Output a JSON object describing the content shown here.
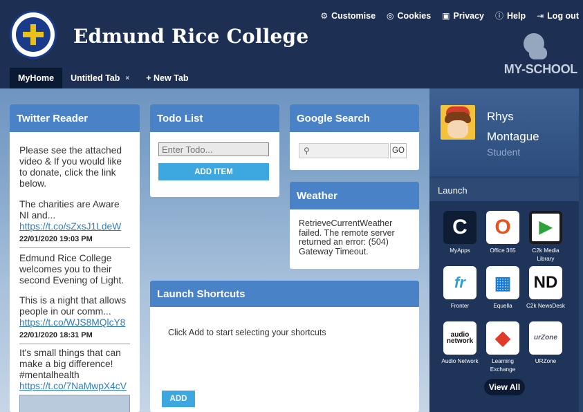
{
  "header": {
    "school_name": "Edmund Rice College",
    "links": [
      {
        "label": "Customise",
        "icon": "gear-icon"
      },
      {
        "label": "Cookies",
        "icon": "cookie-icon"
      },
      {
        "label": "Privacy",
        "icon": "privacy-icon"
      },
      {
        "label": "Help",
        "icon": "help-icon"
      },
      {
        "label": "Log out",
        "icon": "logout-icon"
      }
    ],
    "brand": "MY-SCHOOL"
  },
  "tabs": [
    {
      "label": "MyHome"
    },
    {
      "label": "Untitled Tab",
      "close": "×"
    },
    {
      "label": "+ New Tab"
    }
  ],
  "twitter": {
    "title": "Twitter Reader",
    "tweets": [
      {
        "text": "Please see the attached video & If you would like to donate, click the link below.",
        "link": "",
        "date": ""
      },
      {
        "text": "The charities are Aware NI and...",
        "link": "https://t.co/sZxsJ1LdeW",
        "date": "22/01/2020 19:03 PM"
      },
      {
        "text": "Edmund Rice College welcomes you to their second Evening of Light.",
        "link": "",
        "date": ""
      },
      {
        "text": "This is a night that allows people in our comm...",
        "link": "https://t.co/WJS8MQlcY8",
        "date": "22/01/2020 18:31 PM"
      },
      {
        "text": "It's small things that can make a big difference! #mentalhealth",
        "link": "https://t.co/7NaMwpX4cV",
        "date": ""
      }
    ]
  },
  "todo": {
    "title": "Todo List",
    "placeholder": "Enter Todo...",
    "add_label": "ADD ITEM"
  },
  "google": {
    "title": "Google Search",
    "go_label": "GO"
  },
  "weather": {
    "title": "Weather",
    "message": "RetrieveCurrentWeather failed. The remote server returned an error: (504) Gateway Timeout."
  },
  "shortcuts": {
    "title": "Launch Shortcuts",
    "message": "Click Add to start selecting your shortcuts",
    "add_label": "ADD"
  },
  "profile": {
    "first_name": "Rhys",
    "last_name": "Montague",
    "role": "Student"
  },
  "launch": {
    "title": "Launch",
    "apps": [
      {
        "label": "MyApps",
        "glyph": "C",
        "color": "#1c2a40"
      },
      {
        "label": "Office 365",
        "glyph": "O",
        "color": "#e8541d"
      },
      {
        "label": "C2k Media Library",
        "glyph": "▶",
        "color": "#1a1a1a"
      },
      {
        "label": "Fronter",
        "glyph": "fr",
        "color": "#ffffff"
      },
      {
        "label": "Equella",
        "glyph": "▦",
        "color": "#ffffff"
      },
      {
        "label": "C2k NewsDesk",
        "glyph": "ND",
        "color": "#ffffff"
      },
      {
        "label": "Audio Network",
        "glyph": "audio network",
        "color": "#ffffff"
      },
      {
        "label": "Learning Exchange",
        "glyph": "◆",
        "color": "#ffffff"
      },
      {
        "label": "URZone",
        "glyph": "urZone",
        "color": "#ffffff"
      }
    ],
    "view_all": "View All"
  }
}
